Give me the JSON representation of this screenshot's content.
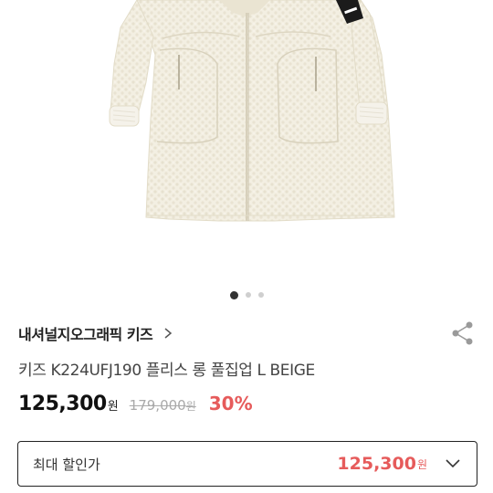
{
  "carousel": {
    "pages": 3,
    "active_index": 0
  },
  "product": {
    "brand": "내셔널지오그래픽 키즈",
    "name": "키즈 K224UFJ190 플리스 롱 풀집업 L BEIGE",
    "price": "125,300",
    "price_unit": "원",
    "original_price": "179,000",
    "original_price_unit": "원",
    "discount": "30%"
  },
  "option_select": {
    "label": "최대 할인가",
    "price": "125,300",
    "price_unit": "원"
  },
  "icons": {
    "brand_link": "chevron-right-icon",
    "share": "share-icon",
    "dropdown": "chevron-down-icon"
  },
  "colors": {
    "accent": "#e65b5b",
    "fleece": "#f3efe2"
  }
}
